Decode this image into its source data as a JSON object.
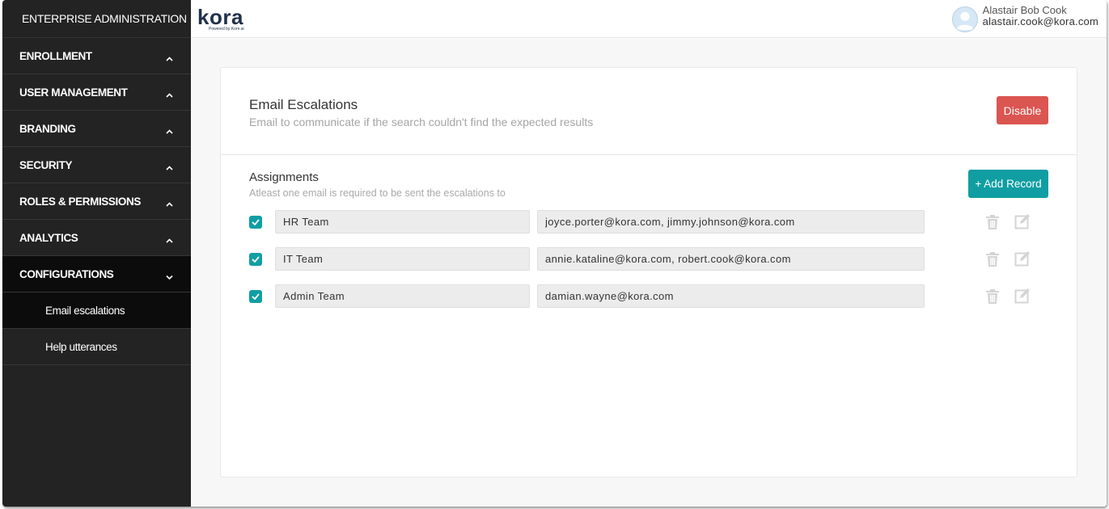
{
  "sidebar": {
    "title": "ENTERPRISE ADMINISTRATION",
    "items": [
      {
        "label": "ENROLLMENT"
      },
      {
        "label": "USER MANAGEMENT"
      },
      {
        "label": "BRANDING"
      },
      {
        "label": "SECURITY"
      },
      {
        "label": "ROLES & PERMISSIONS"
      },
      {
        "label": "ANALYTICS"
      },
      {
        "label": "CONFIGURATIONS"
      }
    ],
    "subitems": [
      {
        "label": "Email escalations"
      },
      {
        "label": "Help utterances"
      }
    ]
  },
  "topbar": {
    "logo_text": "kora",
    "logo_tagline": "Powered by Kore.ai",
    "user_name": "Alastair Bob Cook",
    "user_email": "alastair.cook@kora.com"
  },
  "card": {
    "title": "Email Escalations",
    "subtitle": "Email to communicate if the search couldn't find the expected results",
    "disable_label": "Disable",
    "assignments_title": "Assignments",
    "assignments_subtitle": "Atleast one email is required to be sent the escalations to",
    "add_record_label": "+ Add Record"
  },
  "records": [
    {
      "checked": true,
      "name": "HR Team",
      "emails": "joyce.porter@kora.com, jimmy.johnson@kora.com"
    },
    {
      "checked": true,
      "name": "IT Team",
      "emails": "annie.kataline@kora.com, robert.cook@kora.com"
    },
    {
      "checked": true,
      "name": "Admin Team",
      "emails": "damian.wayne@kora.com"
    }
  ],
  "colors": {
    "sidebar_bg": "#232323",
    "accent": "#109ea3",
    "danger": "#db5551"
  }
}
